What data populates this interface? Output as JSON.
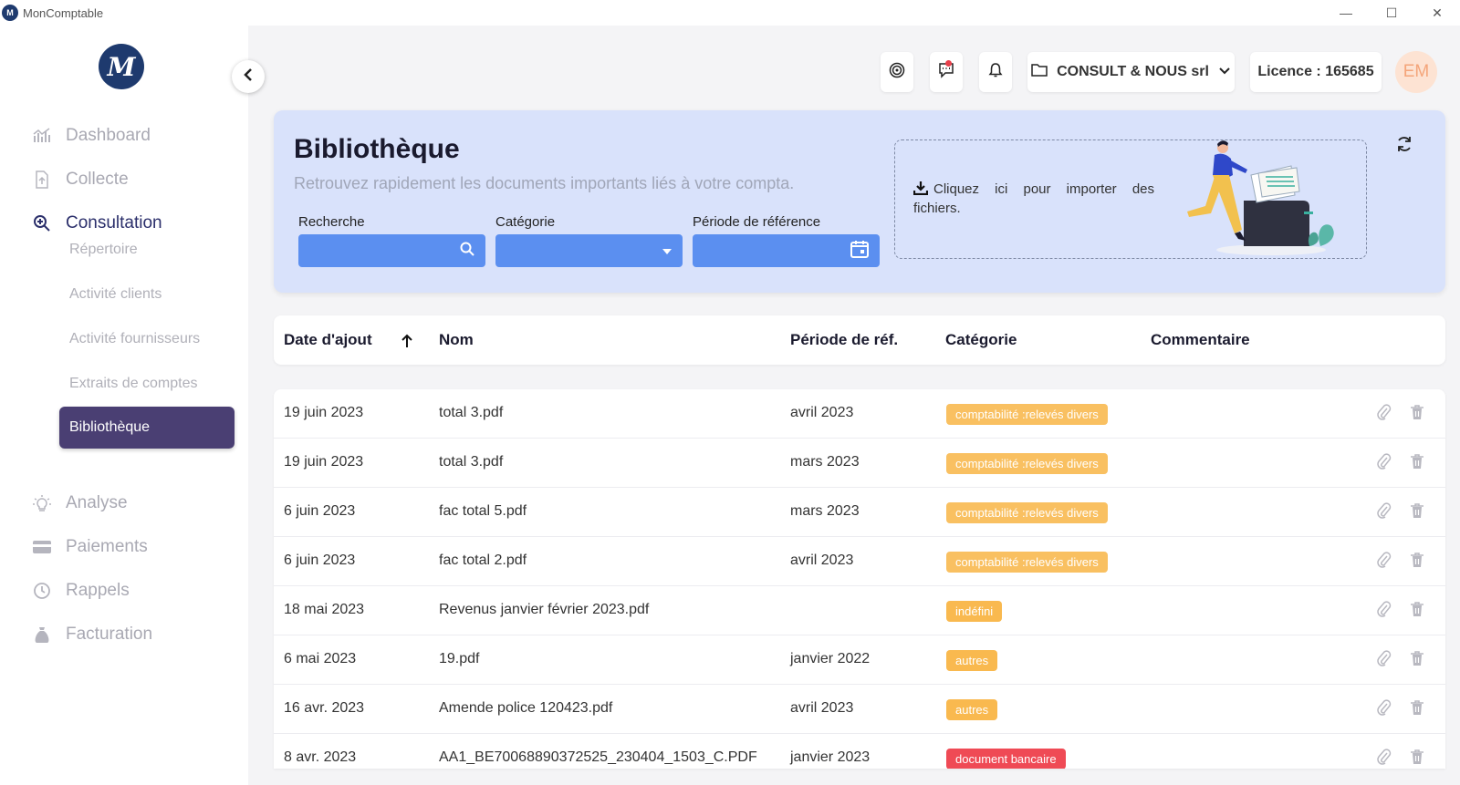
{
  "window": {
    "title": "MonComptable",
    "logo_text": "M"
  },
  "sidebar": {
    "logo_text": "M",
    "items": [
      {
        "label": "Dashboard"
      },
      {
        "label": "Collecte"
      },
      {
        "label": "Consultation"
      },
      {
        "label": "Analyse"
      },
      {
        "label": "Paiements"
      },
      {
        "label": "Rappels"
      },
      {
        "label": "Facturation"
      }
    ],
    "sub_items": [
      {
        "label": "Répertoire"
      },
      {
        "label": "Activité clients"
      },
      {
        "label": "Activité fournisseurs"
      },
      {
        "label": "Extraits de comptes"
      },
      {
        "label": "Bibliothèque"
      }
    ]
  },
  "topbar": {
    "company": "CONSULT & NOUS srl",
    "licence": "Licence : 165685",
    "avatar_initials": "EM"
  },
  "header": {
    "title": "Bibliothèque",
    "subtitle": "Retrouvez rapidement les documents importants liés à votre compta.",
    "filters": {
      "search_label": "Recherche",
      "category_label": "Catégorie",
      "period_label": "Période de référence"
    },
    "upload_line1": "Cliquez ici pour importer des",
    "upload_line2": "fichiers."
  },
  "table": {
    "columns": [
      "Date d'ajout",
      "Nom",
      "Période de réf.",
      "Catégorie",
      "Commentaire"
    ],
    "rows": [
      {
        "date": "19 juin 2023",
        "name": "total 3.pdf",
        "period": "avril 2023",
        "category": "comptabilité :relevés divers",
        "color": "#f9c061"
      },
      {
        "date": "19 juin 2023",
        "name": "total 3.pdf",
        "period": "mars 2023",
        "category": "comptabilité :relevés divers",
        "color": "#f9c061"
      },
      {
        "date": "6 juin 2023",
        "name": "fac total 5.pdf",
        "period": "mars 2023",
        "category": "comptabilité :relevés divers",
        "color": "#f9c061"
      },
      {
        "date": "6 juin 2023",
        "name": "fac total 2.pdf",
        "period": "avril 2023",
        "category": "comptabilité :relevés divers",
        "color": "#f9c061"
      },
      {
        "date": "18 mai 2023",
        "name": "Revenus janvier février 2023.pdf",
        "period": "",
        "category": "indéfini",
        "color": "#f9b94f"
      },
      {
        "date": "6 mai 2023",
        "name": "19.pdf",
        "period": "janvier 2022",
        "category": "autres",
        "color": "#f9b94f"
      },
      {
        "date": "16 avr. 2023",
        "name": "Amende police 120423.pdf",
        "period": "avril 2023",
        "category": "autres",
        "color": "#f9b94f"
      },
      {
        "date": "8 avr. 2023",
        "name": "AA1_BE70068890372525_230404_1503_C.PDF",
        "period": "janvier 2023",
        "category": "document bancaire",
        "color": "#ef4a55"
      }
    ]
  }
}
